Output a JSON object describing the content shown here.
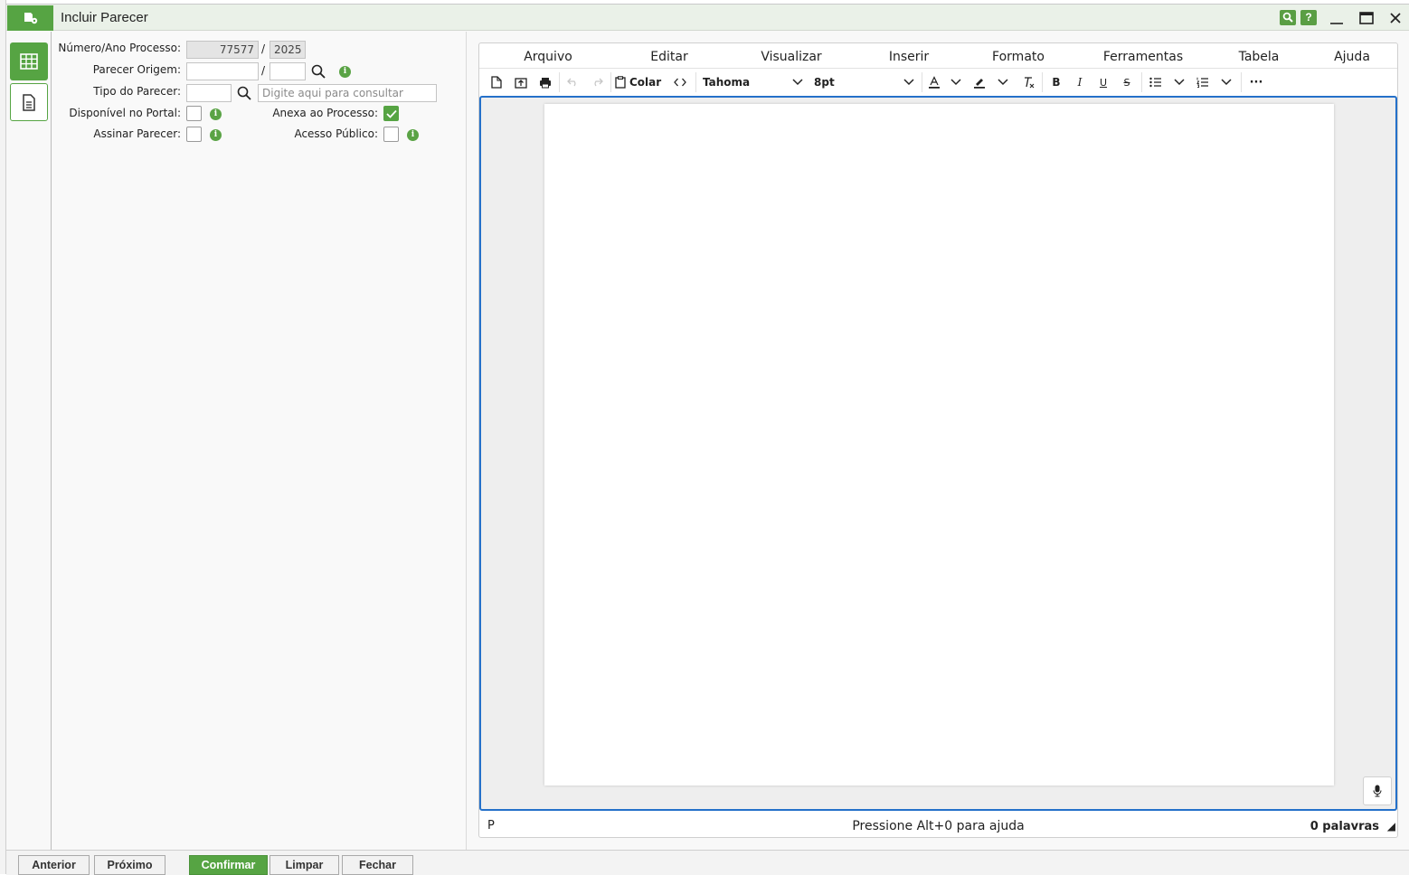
{
  "window": {
    "title": "Incluir Parecer"
  },
  "titlebar_buttons": {
    "search": "search-icon",
    "help_label": "?"
  },
  "form": {
    "numero_ano_label": "Número/Ano Processo:",
    "numero_value": "77577",
    "ano_value": "2025",
    "slash": "/",
    "parecer_origem_label": "Parecer Origem:",
    "parecer_origem_numero": "",
    "parecer_origem_ano": "",
    "tipo_parecer_label": "Tipo do Parecer:",
    "tipo_parecer_code": "",
    "tipo_parecer_placeholder": "Digite aqui para consultar",
    "disponivel_portal_label": "Disponível no Portal:",
    "disponivel_portal_checked": false,
    "anexa_processo_label": "Anexa ao Processo:",
    "anexa_processo_checked": true,
    "assinar_parecer_label": "Assinar Parecer:",
    "assinar_parecer_checked": false,
    "acesso_publico_label": "Acesso Público:",
    "acesso_publico_checked": false,
    "info_glyph": "i"
  },
  "editor": {
    "menu": [
      "Arquivo",
      "Editar",
      "Visualizar",
      "Inserir",
      "Formato",
      "Ferramentas",
      "Tabela",
      "Ajuda"
    ],
    "toolbar": {
      "paste_label": "Colar",
      "font_family": "Tahoma",
      "font_size": "8pt",
      "more": "···"
    },
    "status": {
      "element_path": "P",
      "help_hint": "Pressione Alt+0 para ajuda",
      "word_count": "0 palavras"
    }
  },
  "footer": {
    "anterior": "Anterior",
    "proximo": "Próximo",
    "confirmar": "Confirmar",
    "limpar": "Limpar",
    "fechar": "Fechar"
  },
  "colors": {
    "brand_green": "#56a443",
    "focus_blue": "#2470c9"
  }
}
